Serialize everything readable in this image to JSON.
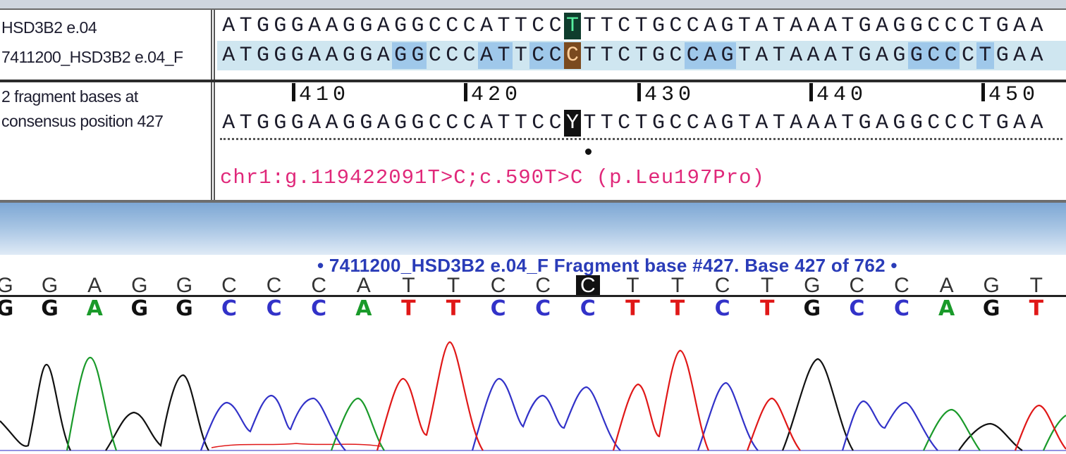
{
  "alignment": {
    "reference_label": "HSD3B2 e.04",
    "fragment_label": "7411200_HSD3B2 e.04_F",
    "consensus_label_line1": "2 fragment  bases  at",
    "consensus_label_line2": "consensus position 427",
    "reference_seq": "ATGGGAAGGAGGCCCATTCCTTTCTGCCAGTATAAATGAGGCCCTGAA",
    "fragment_seq": "ATGGGAAGGAGGCCCATTCCCTTCTGCCAGTATAAATGAGGCCCTGAA",
    "consensus_seq": "ATGGGAAGGAGGCCCATTCCYTTCTGCCAGTATAAATGAGGCCCTGAA",
    "ruler_labels": [
      "410",
      "420",
      "430",
      "440",
      "450"
    ],
    "mutation_annotation": "chr1:g.119422091T>C;c.590T>C (p.Leu197Pro)"
  },
  "trace": {
    "fragment_info": "• 7411200_HSD3B2 e.04_F Fragment base #427. Base 427 of 762 •",
    "base_calls": [
      "G",
      "G",
      "A",
      "G",
      "G",
      "C",
      "C",
      "C",
      "A",
      "T",
      "T",
      "C",
      "C",
      "C",
      "T",
      "T",
      "C",
      "T",
      "G",
      "C",
      "C",
      "A",
      "G",
      "T"
    ],
    "selected_call_index": 13,
    "colors": {
      "A": "#1a9a2a",
      "C": "#3232c8",
      "G": "#111111",
      "T": "#e01818"
    }
  }
}
